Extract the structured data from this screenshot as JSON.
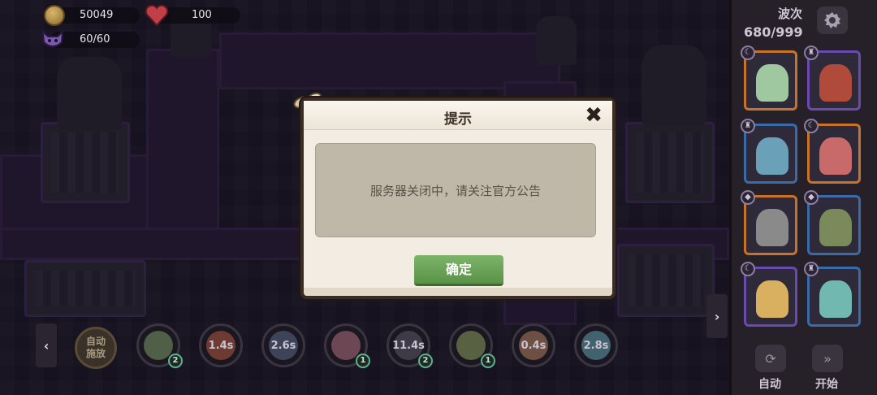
{
  "resources": {
    "gold": "50049",
    "health": "100",
    "units": "60/60"
  },
  "wave": {
    "label": "波次",
    "count": "680/999"
  },
  "dialog": {
    "title": "提示",
    "message": "服务器关闭中，请关注官方公告",
    "confirm_label": "确定",
    "close_glyph": "✖"
  },
  "skill_bar": {
    "auto_cast_label_line1": "自动",
    "auto_cast_label_line2": "施放",
    "skills": [
      {
        "cooldown": "",
        "level": "2",
        "color": "#7a9a6a"
      },
      {
        "cooldown": "1.4s",
        "level": "",
        "color": "#b05a40"
      },
      {
        "cooldown": "2.6s",
        "level": "",
        "color": "#5a6a8a"
      },
      {
        "cooldown": "",
        "level": "1",
        "color": "#b07080"
      },
      {
        "cooldown": "11.4s",
        "level": "2",
        "color": "#5a5a6a"
      },
      {
        "cooldown": "",
        "level": "1",
        "color": "#8aa060"
      },
      {
        "cooldown": "0.4s",
        "level": "",
        "color": "#b08060"
      },
      {
        "cooldown": "2.8s",
        "level": "",
        "color": "#60a0b0"
      }
    ]
  },
  "controls": {
    "auto_label": "自动",
    "start_label": "开始"
  },
  "hero_cards": [
    {
      "border": "#c8722a",
      "sprite": "#9fc7a0",
      "badge_icon": "moon-icon"
    },
    {
      "border": "#6a4ab0",
      "sprite": "#b04a3a",
      "badge_icon": "trophy-icon"
    },
    {
      "border": "#3a6aa8",
      "sprite": "#6aa0b8",
      "badge_icon": "trophy-icon"
    },
    {
      "border": "#c8722a",
      "sprite": "#c86a6a",
      "badge_icon": "moon-icon"
    },
    {
      "border": "#c8722a",
      "sprite": "#8a8a8a",
      "badge_icon": "diamond-icon"
    },
    {
      "border": "#3a6aa8",
      "sprite": "#7a8a5a",
      "badge_icon": "diamond-icon"
    },
    {
      "border": "#6a4ab0",
      "sprite": "#d8b060",
      "badge_icon": "moon-icon"
    },
    {
      "border": "#3a6aa8",
      "sprite": "#70b8b0",
      "badge_icon": "trophy-icon"
    }
  ],
  "colors": {
    "confirm_button": "#6aa458",
    "dialog_frame": "#3b2c25",
    "panel_bg": "#262029"
  }
}
